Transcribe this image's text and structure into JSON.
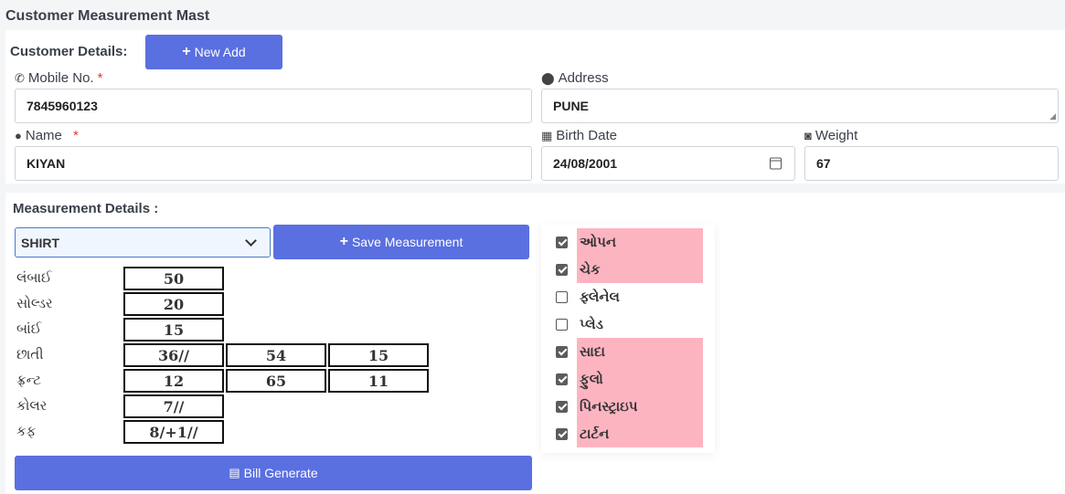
{
  "page": {
    "title": "Customer Measurement Mast"
  },
  "customer": {
    "section_label": "Customer Details:",
    "new_add_label": "New Add",
    "mobile": {
      "label": "Mobile No.",
      "required": "*",
      "value": "7845960123"
    },
    "address": {
      "label": "Address",
      "value": "PUNE"
    },
    "name": {
      "label": "Name",
      "required": "*",
      "value": "KIYAN"
    },
    "birth_date": {
      "label": "Birth Date",
      "value": "24/08/2001"
    },
    "weight": {
      "label": "Weight",
      "value": "67"
    }
  },
  "measurement": {
    "section_label": "Measurement Details :",
    "garment_selected": "SHIRT",
    "save_label": "Save Measurement",
    "bill_label": "Bill Generate",
    "rows": [
      {
        "label": "લંબાઈ",
        "values": [
          "50"
        ]
      },
      {
        "label": "સોલ્ડર",
        "values": [
          "20"
        ]
      },
      {
        "label": "બાંઈ",
        "values": [
          "15"
        ]
      },
      {
        "label": "છાતી",
        "values": [
          "36//",
          "54",
          "15"
        ]
      },
      {
        "label": "ફ્રન્ટ",
        "values": [
          "12",
          "65",
          "11"
        ]
      },
      {
        "label": "કોલર",
        "values": [
          "7//"
        ]
      },
      {
        "label": "કફ",
        "values": [
          "8/+1//"
        ]
      }
    ],
    "options": [
      {
        "label": "ઓપન",
        "checked": true
      },
      {
        "label": "ચેક",
        "checked": true
      },
      {
        "label": "ફ્લેનેલ",
        "checked": false
      },
      {
        "label": "પ્લેડ",
        "checked": false
      },
      {
        "label": "સાદા",
        "checked": true
      },
      {
        "label": "ફુલો",
        "checked": true
      },
      {
        "label": "પિનસ્ટ્રાઇપ",
        "checked": true
      },
      {
        "label": "ટાર્ટન",
        "checked": true
      }
    ]
  },
  "colors": {
    "primary_button": "#5a6fe0",
    "highlight": "#fdb4c1",
    "required": "#e53935"
  },
  "icons": {
    "new_add": "plus-icon",
    "save": "plus-icon",
    "bill": "file-icon",
    "mobile": "phone-icon",
    "address": "map-marker-icon",
    "name": "user-icon",
    "birth_date": "calendar-icon",
    "weight": "scale-icon",
    "select": "chevron-down-icon"
  }
}
